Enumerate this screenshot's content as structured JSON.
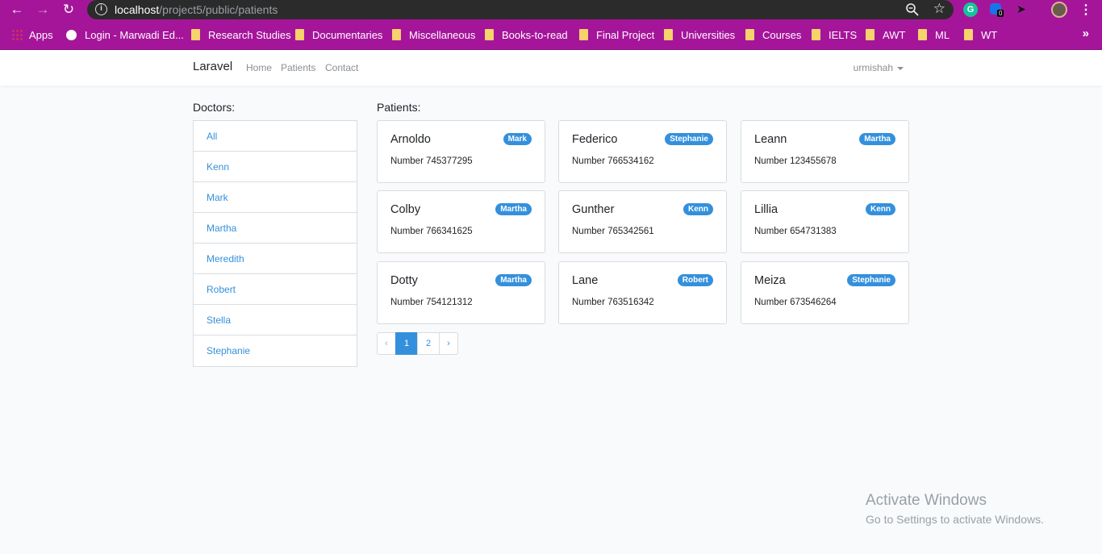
{
  "browser": {
    "url_host": "localhost",
    "url_path": "/project5/public/patients",
    "extension_badge": "0",
    "bookmarks": [
      "Apps",
      "Login - Marwadi Ed...",
      "Research Studies",
      "Documentaries",
      "Miscellaneous",
      "Books-to-read",
      "Final Project",
      "Universities",
      "Courses",
      "IELTS",
      "AWT",
      "ML",
      "WT"
    ],
    "more": "»"
  },
  "navbar": {
    "brand": "Laravel",
    "links": [
      "Home",
      "Patients",
      "Contact"
    ],
    "user": "urmishah"
  },
  "doctors": {
    "title": "Doctors:",
    "items": [
      "All",
      "Kenn",
      "Mark",
      "Martha",
      "Meredith",
      "Robert",
      "Stella",
      "Stephanie"
    ]
  },
  "patients": {
    "title": "Patients:",
    "cards": [
      {
        "name": "Arnoldo",
        "doctor": "Mark",
        "number": "Number 745377295"
      },
      {
        "name": "Federico",
        "doctor": "Stephanie",
        "number": "Number 766534162"
      },
      {
        "name": "Leann",
        "doctor": "Martha",
        "number": "Number 123455678"
      },
      {
        "name": "Colby",
        "doctor": "Martha",
        "number": "Number 766341625"
      },
      {
        "name": "Gunther",
        "doctor": "Kenn",
        "number": "Number 765342561"
      },
      {
        "name": "Lillia",
        "doctor": "Kenn",
        "number": "Number 654731383"
      },
      {
        "name": "Dotty",
        "doctor": "Martha",
        "number": "Number 754121312"
      },
      {
        "name": "Lane",
        "doctor": "Robert",
        "number": "Number 763516342"
      },
      {
        "name": "Meiza",
        "doctor": "Stephanie",
        "number": "Number 673546264"
      }
    ]
  },
  "pagination": {
    "prev": "‹",
    "pages": [
      "1",
      "2"
    ],
    "active": "1",
    "next": "›"
  },
  "watermark": {
    "line1": "Activate Windows",
    "line2": "Go to Settings to activate Windows."
  },
  "colors": {
    "chrome": "#a5159a",
    "accent": "#3490dc",
    "background": "#f8fafc"
  }
}
